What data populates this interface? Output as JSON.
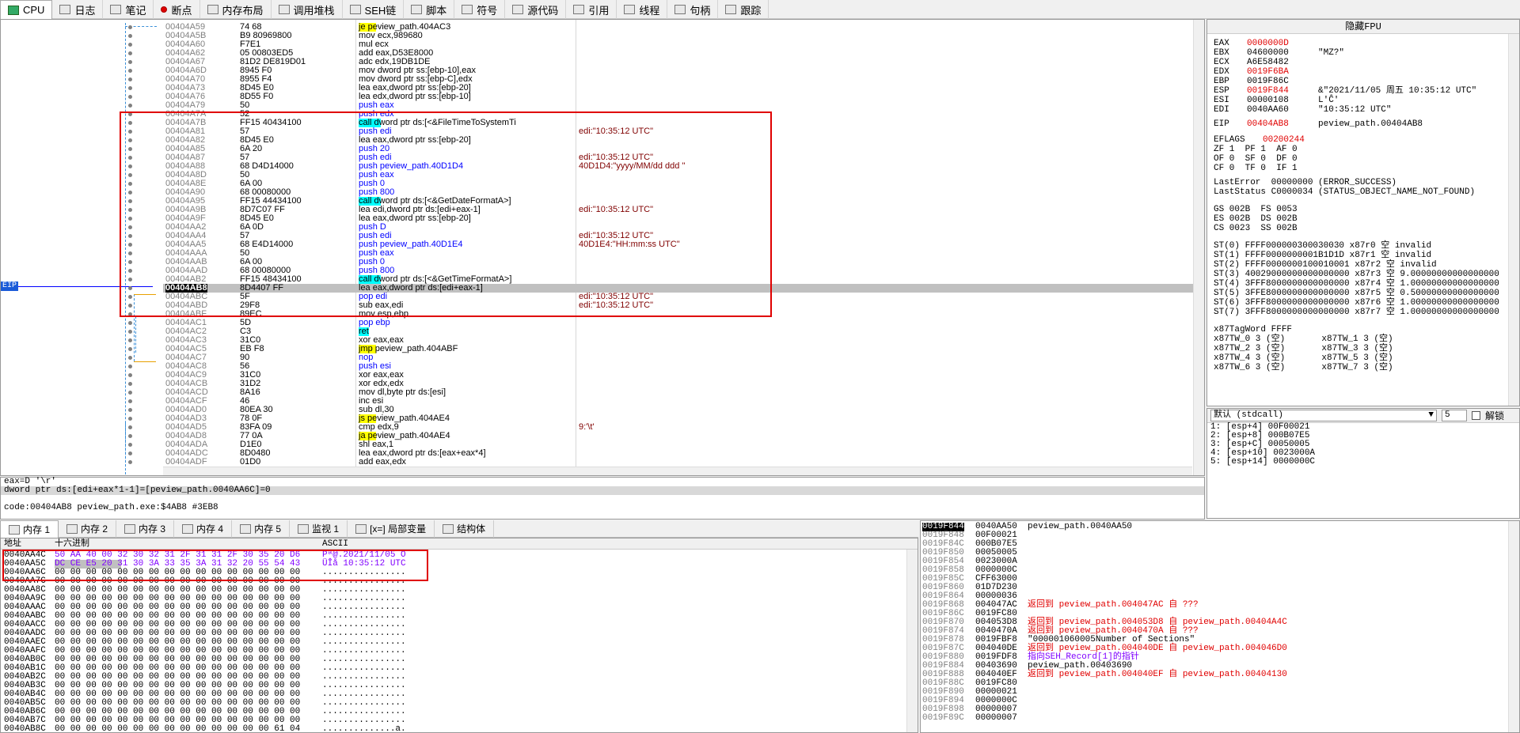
{
  "tabs": [
    {
      "label": "CPU",
      "icon": "cpu-icon",
      "active": true
    },
    {
      "label": "日志",
      "icon": "log-icon"
    },
    {
      "label": "笔记",
      "icon": "notes-icon"
    },
    {
      "label": "断点",
      "icon": "breakpoint-icon"
    },
    {
      "label": "内存布局",
      "icon": "memory-map-icon"
    },
    {
      "label": "调用堆栈",
      "icon": "call-stack-icon"
    },
    {
      "label": "SEH链",
      "icon": "seh-chain-icon"
    },
    {
      "label": "脚本",
      "icon": "script-icon"
    },
    {
      "label": "符号",
      "icon": "symbols-icon"
    },
    {
      "label": "源代码",
      "icon": "source-icon"
    },
    {
      "label": "引用",
      "icon": "references-icon"
    },
    {
      "label": "线程",
      "icon": "threads-icon"
    },
    {
      "label": "句柄",
      "icon": "handles-icon"
    },
    {
      "label": "跟踪",
      "icon": "trace-icon"
    }
  ],
  "disasm": {
    "eip_label": "EIP",
    "rows": [
      {
        "addr": "00404A59",
        "bytes": "74 68",
        "instr": "je peview_path.404AC3",
        "kind": "jmp",
        "cmt": ""
      },
      {
        "addr": "00404A5B",
        "bytes": "B9 80969800",
        "instr": "mov ecx,989680",
        "kind": "",
        "cmt": ""
      },
      {
        "addr": "00404A60",
        "bytes": "F7E1",
        "instr": "mul ecx",
        "kind": "",
        "cmt": ""
      },
      {
        "addr": "00404A62",
        "bytes": "05 00803ED5",
        "instr": "add eax,D53E8000",
        "kind": "",
        "cmt": ""
      },
      {
        "addr": "00404A67",
        "bytes": "81D2 DE819D01",
        "instr": "adc edx,19DB1DE",
        "kind": "",
        "cmt": ""
      },
      {
        "addr": "00404A6D",
        "bytes": "8945 F0",
        "instr": "mov dword ptr ss:[ebp-10],eax",
        "kind": "",
        "cmt": ""
      },
      {
        "addr": "00404A70",
        "bytes": "8955 F4",
        "instr": "mov dword ptr ss:[ebp-C],edx",
        "kind": "",
        "cmt": ""
      },
      {
        "addr": "00404A73",
        "bytes": "8D45 E0",
        "instr": "lea eax,dword ptr ss:[ebp-20]",
        "kind": "",
        "cmt": ""
      },
      {
        "addr": "00404A76",
        "bytes": "8D55 F0",
        "instr": "lea edx,dword ptr ss:[ebp-10]",
        "kind": "",
        "cmt": ""
      },
      {
        "addr": "00404A79",
        "bytes": "50",
        "instr": "push eax",
        "kind": "push",
        "cmt": ""
      },
      {
        "addr": "00404A7A",
        "bytes": "52",
        "instr": "push edx",
        "kind": "push",
        "cmt": ""
      },
      {
        "addr": "00404A7B",
        "bytes": "FF15 40434100",
        "instr": "call dword ptr ds:[<&FileTimeToSystemTi",
        "kind": "call",
        "cmt": ""
      },
      {
        "addr": "00404A81",
        "bytes": "57",
        "instr": "push edi",
        "kind": "push",
        "cmt": "edi:\"10:35:12 UTC\""
      },
      {
        "addr": "00404A82",
        "bytes": "8D45 E0",
        "instr": "lea eax,dword ptr ss:[ebp-20]",
        "kind": "",
        "cmt": ""
      },
      {
        "addr": "00404A85",
        "bytes": "6A 20",
        "instr": "push 20",
        "kind": "push",
        "cmt": ""
      },
      {
        "addr": "00404A87",
        "bytes": "57",
        "instr": "push edi",
        "kind": "push",
        "cmt": "edi:\"10:35:12 UTC\""
      },
      {
        "addr": "00404A88",
        "bytes": "68 D4D14000",
        "instr": "push peview_path.40D1D4",
        "kind": "push",
        "cmt": "40D1D4:\"yyyy/MM/dd ddd \""
      },
      {
        "addr": "00404A8D",
        "bytes": "50",
        "instr": "push eax",
        "kind": "push",
        "cmt": ""
      },
      {
        "addr": "00404A8E",
        "bytes": "6A 00",
        "instr": "push 0",
        "kind": "push",
        "cmt": ""
      },
      {
        "addr": "00404A90",
        "bytes": "68 00080000",
        "instr": "push 800",
        "kind": "push",
        "cmt": ""
      },
      {
        "addr": "00404A95",
        "bytes": "FF15 44434100",
        "instr": "call dword ptr ds:[<&GetDateFormatA>]",
        "kind": "call",
        "cmt": ""
      },
      {
        "addr": "00404A9B",
        "bytes": "8D7C07 FF",
        "instr": "lea edi,dword ptr ds:[edi+eax-1]",
        "kind": "",
        "cmt": "edi:\"10:35:12 UTC\""
      },
      {
        "addr": "00404A9F",
        "bytes": "8D45 E0",
        "instr": "lea eax,dword ptr ss:[ebp-20]",
        "kind": "",
        "cmt": ""
      },
      {
        "addr": "00404AA2",
        "bytes": "6A 0D",
        "instr": "push D",
        "kind": "push",
        "cmt": ""
      },
      {
        "addr": "00404AA4",
        "bytes": "57",
        "instr": "push edi",
        "kind": "push",
        "cmt": "edi:\"10:35:12 UTC\""
      },
      {
        "addr": "00404AA5",
        "bytes": "68 E4D14000",
        "instr": "push peview_path.40D1E4",
        "kind": "push",
        "cmt": "40D1E4:\"HH:mm:ss UTC\""
      },
      {
        "addr": "00404AAA",
        "bytes": "50",
        "instr": "push eax",
        "kind": "push",
        "cmt": ""
      },
      {
        "addr": "00404AAB",
        "bytes": "6A 00",
        "instr": "push 0",
        "kind": "push",
        "cmt": ""
      },
      {
        "addr": "00404AAD",
        "bytes": "68 00080000",
        "instr": "push 800",
        "kind": "push",
        "cmt": ""
      },
      {
        "addr": "00404AB2",
        "bytes": "FF15 48434100",
        "instr": "call dword ptr ds:[<&GetTimeFormatA>]",
        "kind": "call",
        "cmt": ""
      },
      {
        "addr": "00404AB8",
        "bytes": "8D4407 FF",
        "instr": "lea eax,dword ptr ds:[edi+eax-1]",
        "kind": "cur",
        "cmt": ""
      },
      {
        "addr": "00404ABC",
        "bytes": "5F",
        "instr": "pop edi",
        "kind": "push",
        "cmt": "edi:\"10:35:12 UTC\""
      },
      {
        "addr": "00404ABD",
        "bytes": "29F8",
        "instr": "sub eax,edi",
        "kind": "",
        "cmt": "edi:\"10:35:12 UTC\""
      },
      {
        "addr": "00404ABF",
        "bytes": "89EC",
        "instr": "mov esp,ebp",
        "kind": "",
        "cmt": ""
      },
      {
        "addr": "00404AC1",
        "bytes": "5D",
        "instr": "pop ebp",
        "kind": "push",
        "cmt": ""
      },
      {
        "addr": "00404AC2",
        "bytes": "C3",
        "instr": "ret",
        "kind": "ret",
        "cmt": ""
      },
      {
        "addr": "00404AC3",
        "bytes": "31C0",
        "instr": "xor eax,eax",
        "kind": "",
        "cmt": ""
      },
      {
        "addr": "00404AC5",
        "bytes": "EB F8",
        "instr": "jmp peview_path.404ABF",
        "kind": "jmp",
        "cmt": ""
      },
      {
        "addr": "00404AC7",
        "bytes": "90",
        "instr": "nop",
        "kind": "nop",
        "cmt": ""
      },
      {
        "addr": "00404AC8",
        "bytes": "56",
        "instr": "push esi",
        "kind": "push",
        "cmt": ""
      },
      {
        "addr": "00404AC9",
        "bytes": "31C0",
        "instr": "xor eax,eax",
        "kind": "",
        "cmt": ""
      },
      {
        "addr": "00404ACB",
        "bytes": "31D2",
        "instr": "xor edx,edx",
        "kind": "",
        "cmt": ""
      },
      {
        "addr": "00404ACD",
        "bytes": "8A16",
        "instr": "mov dl,byte ptr ds:[esi]",
        "kind": "",
        "cmt": ""
      },
      {
        "addr": "00404ACF",
        "bytes": "46",
        "instr": "inc esi",
        "kind": "",
        "cmt": ""
      },
      {
        "addr": "00404AD0",
        "bytes": "80EA 30",
        "instr": "sub dl,30",
        "kind": "",
        "cmt": ""
      },
      {
        "addr": "00404AD3",
        "bytes": "78 0F",
        "instr": "js peview_path.404AE4",
        "kind": "jmp",
        "cmt": ""
      },
      {
        "addr": "00404AD5",
        "bytes": "83FA 09",
        "instr": "cmp edx,9",
        "kind": "",
        "cmt": "9:'\\t'"
      },
      {
        "addr": "00404AD8",
        "bytes": "77 0A",
        "instr": "ja peview_path.404AE4",
        "kind": "jmp",
        "cmt": ""
      },
      {
        "addr": "00404ADA",
        "bytes": "D1E0",
        "instr": "shl eax,1",
        "kind": "",
        "cmt": ""
      },
      {
        "addr": "00404ADC",
        "bytes": "8D0480",
        "instr": "lea eax,dword ptr ds:[eax+eax*4]",
        "kind": "",
        "cmt": ""
      },
      {
        "addr": "00404ADF",
        "bytes": "01D0",
        "instr": "add eax,edx",
        "kind": "",
        "cmt": ""
      }
    ]
  },
  "info": {
    "line1": "eax=D '\\r'",
    "line2": "dword ptr ds:[edi+eax*1-1]=[peview_path.0040AA6C]=0",
    "line3": "",
    "line4": "code:00404AB8 peview_path.exe:$4AB8 #3EB8"
  },
  "registers": {
    "header": "隐藏FPU",
    "gp": [
      {
        "name": "EAX",
        "value": "0000000D",
        "comment": "",
        "red": true
      },
      {
        "name": "EBX",
        "value": "04600000",
        "comment": "\"MZ?\"",
        "red": false
      },
      {
        "name": "ECX",
        "value": "A6E58482",
        "comment": "",
        "red": false
      },
      {
        "name": "EDX",
        "value": "0019F6BA",
        "comment": "",
        "red": true
      },
      {
        "name": "EBP",
        "value": "0019F86C",
        "comment": "",
        "red": false
      },
      {
        "name": "ESP",
        "value": "0019F844",
        "comment": "&\"2021/11/05 周五 10:35:12 UTC\"",
        "red": true
      },
      {
        "name": "ESI",
        "value": "00000108",
        "comment": "L'Ĉ'",
        "red": false
      },
      {
        "name": "EDI",
        "value": "0040AA60",
        "comment": "\"10:35:12 UTC\"",
        "red": false
      }
    ],
    "eip": {
      "name": "EIP",
      "value": "00404AB8",
      "comment": "peview_path.00404AB8"
    },
    "eflags": {
      "name": "EFLAGS",
      "value": "00200244"
    },
    "flags": [
      "ZF 1  PF 1  AF 0",
      "OF 0  SF 0  DF 0",
      "CF 0  TF 0  IF 1"
    ],
    "last_error": "LastError  00000000 (ERROR_SUCCESS)",
    "last_status": "LastStatus C0000034 (STATUS_OBJECT_NAME_NOT_FOUND)",
    "segs": [
      "GS 002B  FS 0053",
      "ES 002B  DS 002B",
      "CS 0023  SS 002B"
    ],
    "fpu": [
      "ST(0) FFFF000000300030030 x87r0 空 invalid",
      "ST(1) FFFF0000000001B1D1D x87r1 空 invalid",
      "ST(2) FFFF0000000100010001 x87r2 空 invalid",
      "ST(3) 40029000000000000000 x87r3 空 9.00000000000000000",
      "ST(4) 3FFF8000000000000000 x87r4 空 1.00000000000000000",
      "ST(5) 3FFE8000000000000000 x87r5 空 0.50000000000000000",
      "ST(6) 3FFF8000000000000000 x87r6 空 1.00000000000000000",
      "ST(7) 3FFF8000000000000000 x87r7 空 1.00000000000000000"
    ],
    "tagword": "x87TagWord FFFF",
    "tags": [
      "x87TW_0 3 (空)       x87TW_1 3 (空)",
      "x87TW_2 3 (空)       x87TW_3 3 (空)",
      "x87TW_4 3 (空)       x87TW_5 3 (空)",
      "x87TW_6 3 (空)       x87TW_7 3 (空)"
    ]
  },
  "callconv": {
    "selected": "默认 (stdcall)",
    "count": "5",
    "unlock_label": "解锁",
    "args": [
      "1: [esp+4] 00F00021",
      "2: [esp+8] 000B07E5",
      "3: [esp+C] 00050005",
      "4: [esp+10] 0023000A",
      "5: [esp+14] 0000000C"
    ]
  },
  "memtabs": [
    {
      "label": "内存 1",
      "active": true
    },
    {
      "label": "内存 2"
    },
    {
      "label": "内存 3"
    },
    {
      "label": "内存 4"
    },
    {
      "label": "内存 5"
    },
    {
      "label": "监视 1"
    },
    {
      "label": "[x=] 局部变量"
    },
    {
      "label": "结构体"
    }
  ],
  "dump": {
    "hdr_addr": "地址",
    "hdr_hex": "十六进制",
    "hdr_ascii": "ASCII",
    "rows": [
      {
        "a": "0040AA4C",
        "h": "50 AA 40 00 32 30 32 31 2F 31 31 2F 30 35 20 D6",
        "s": "Pª@.2021/11/05 Ö"
      },
      {
        "a": "0040AA5C",
        "h": "DC CE E5 20 31 30 3A 33 35 3A 31 32 20 55 54 43",
        "s": "ÜÎå 10:35:12 UTC"
      },
      {
        "a": "0040AA6C",
        "h": "00 00 00 00 00 00 00 00 00 00 00 00 00 00 00 00",
        "s": "................"
      },
      {
        "a": "0040AA7C",
        "h": "00 00 00 00 00 00 00 00 00 00 00 00 00 00 00 00",
        "s": "................"
      },
      {
        "a": "0040AA8C",
        "h": "00 00 00 00 00 00 00 00 00 00 00 00 00 00 00 00",
        "s": "................"
      },
      {
        "a": "0040AA9C",
        "h": "00 00 00 00 00 00 00 00 00 00 00 00 00 00 00 00",
        "s": "................"
      },
      {
        "a": "0040AAAC",
        "h": "00 00 00 00 00 00 00 00 00 00 00 00 00 00 00 00",
        "s": "................"
      },
      {
        "a": "0040AABC",
        "h": "00 00 00 00 00 00 00 00 00 00 00 00 00 00 00 00",
        "s": "................"
      },
      {
        "a": "0040AACC",
        "h": "00 00 00 00 00 00 00 00 00 00 00 00 00 00 00 00",
        "s": "................"
      },
      {
        "a": "0040AADC",
        "h": "00 00 00 00 00 00 00 00 00 00 00 00 00 00 00 00",
        "s": "................"
      },
      {
        "a": "0040AAEC",
        "h": "00 00 00 00 00 00 00 00 00 00 00 00 00 00 00 00",
        "s": "................"
      },
      {
        "a": "0040AAFC",
        "h": "00 00 00 00 00 00 00 00 00 00 00 00 00 00 00 00",
        "s": "................"
      },
      {
        "a": "0040AB0C",
        "h": "00 00 00 00 00 00 00 00 00 00 00 00 00 00 00 00",
        "s": "................"
      },
      {
        "a": "0040AB1C",
        "h": "00 00 00 00 00 00 00 00 00 00 00 00 00 00 00 00",
        "s": "................"
      },
      {
        "a": "0040AB2C",
        "h": "00 00 00 00 00 00 00 00 00 00 00 00 00 00 00 00",
        "s": "................"
      },
      {
        "a": "0040AB3C",
        "h": "00 00 00 00 00 00 00 00 00 00 00 00 00 00 00 00",
        "s": "................"
      },
      {
        "a": "0040AB4C",
        "h": "00 00 00 00 00 00 00 00 00 00 00 00 00 00 00 00",
        "s": "................"
      },
      {
        "a": "0040AB5C",
        "h": "00 00 00 00 00 00 00 00 00 00 00 00 00 00 00 00",
        "s": "................"
      },
      {
        "a": "0040AB6C",
        "h": "00 00 00 00 00 00 00 00 00 00 00 00 00 00 00 00",
        "s": "................"
      },
      {
        "a": "0040AB7C",
        "h": "00 00 00 00 00 00 00 00 00 00 00 00 00 00 00 00",
        "s": "................"
      },
      {
        "a": "0040AB8C",
        "h": "00 00 00 00 00 00 00 00 00 00 00 00 00 00 61 04",
        "s": "..............a."
      }
    ]
  },
  "stack": {
    "rows": [
      {
        "a": "0019F844",
        "v": "0040AA50",
        "c": "peview_path.0040AA50",
        "t": "",
        "sel": true
      },
      {
        "a": "0019F848",
        "v": "00F00021",
        "c": "",
        "t": ""
      },
      {
        "a": "0019F84C",
        "v": "000B07E5",
        "c": "",
        "t": ""
      },
      {
        "a": "0019F850",
        "v": "00050005",
        "c": "",
        "t": ""
      },
      {
        "a": "0019F854",
        "v": "0023000A",
        "c": "",
        "t": ""
      },
      {
        "a": "0019F858",
        "v": "0000000C",
        "c": "",
        "t": ""
      },
      {
        "a": "0019F85C",
        "v": "CFF63000",
        "c": "",
        "t": ""
      },
      {
        "a": "0019F860",
        "v": "01D7D230",
        "c": "",
        "t": ""
      },
      {
        "a": "0019F864",
        "v": "00000036",
        "c": "",
        "t": ""
      },
      {
        "a": "0019F868",
        "v": "004047AC",
        "c": "返回到 peview_path.004047AC 自 ???",
        "t": "r"
      },
      {
        "a": "0019F86C",
        "v": "0019FC80",
        "c": "",
        "t": ""
      },
      {
        "a": "0019F870",
        "v": "004053D8",
        "c": "返回到 peview_path.004053D8 自 peview_path.00404A4C",
        "t": "r"
      },
      {
        "a": "0019F874",
        "v": "0040470A",
        "c": "返回到 peview_path.0040470A 自 ???",
        "t": "r"
      },
      {
        "a": "0019F878",
        "v": "0019FBF8",
        "c": "\"000001060005Number of Sections\"",
        "t": ""
      },
      {
        "a": "0019F87C",
        "v": "004040DE",
        "c": "返回到 peview_path.004040DE 自 peview_path.004046D0",
        "t": "r"
      },
      {
        "a": "0019F880",
        "v": "0019FDF8",
        "c": "指向SEH_Record[1]的指针",
        "t": "m"
      },
      {
        "a": "0019F884",
        "v": "00403690",
        "c": "peview_path.00403690",
        "t": ""
      },
      {
        "a": "0019F888",
        "v": "004040EF",
        "c": "返回到 peview_path.004040EF 自 peview_path.00404130",
        "t": "r"
      },
      {
        "a": "0019F88C",
        "v": "0019FC80",
        "c": "",
        "t": ""
      },
      {
        "a": "0019F890",
        "v": "00000021",
        "c": "",
        "t": ""
      },
      {
        "a": "0019F894",
        "v": "0000000C",
        "c": "",
        "t": ""
      },
      {
        "a": "0019F898",
        "v": "00000007",
        "c": "",
        "t": ""
      },
      {
        "a": "0019F89C",
        "v": "00000007",
        "c": "",
        "t": ""
      }
    ]
  }
}
